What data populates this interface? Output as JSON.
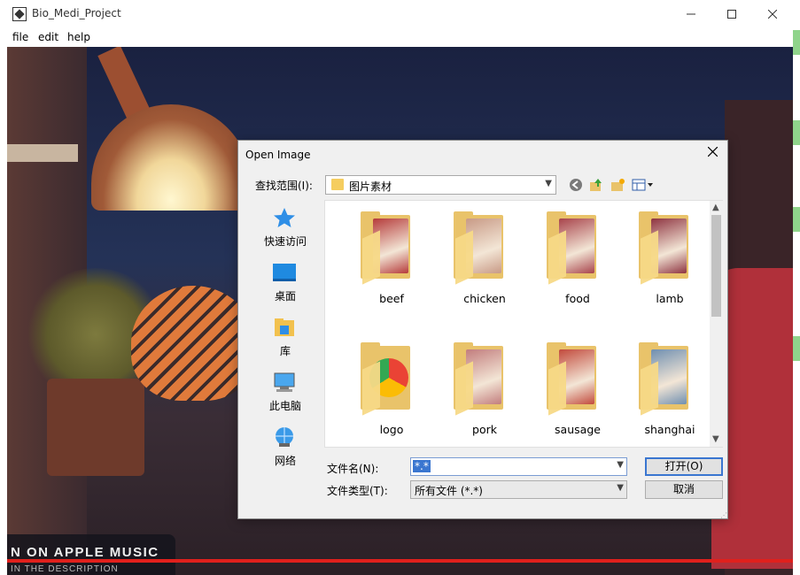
{
  "window": {
    "title": "Bio_Medi_Project"
  },
  "menu": [
    "file",
    "edit",
    "help"
  ],
  "background": {
    "banner_text": "N ON APPLE MUSIC",
    "banner_sub": "IN THE DESCRIPTION"
  },
  "dialog": {
    "title": "Open Image",
    "look_in_label": "查找范围(I):",
    "look_in_value": "图片素材",
    "places": [
      "快速访问",
      "桌面",
      "库",
      "此电脑",
      "网络"
    ],
    "items": [
      {
        "label": "beef",
        "color": "#b53a3a"
      },
      {
        "label": "chicken",
        "color": "#c89a86"
      },
      {
        "label": "food",
        "color": "#a8434b"
      },
      {
        "label": "lamb",
        "color": "#8e3340"
      },
      {
        "label": "logo",
        "color": "#4285f4"
      },
      {
        "label": "pork",
        "color": "#c27d7d"
      },
      {
        "label": "sausage",
        "color": "#c24a3c"
      },
      {
        "label": "shanghai",
        "color": "#6f8fb0"
      }
    ],
    "file_name_label": "文件名(N):",
    "file_name_value": "*.*",
    "file_type_label": "文件类型(T):",
    "file_type_value": "所有文件 (*.*)",
    "open_label": "打开(O)",
    "cancel_label": "取消"
  },
  "colors": {
    "accent": "#3a76d0",
    "folder": "#e9c36a",
    "progress": "#e0201c"
  }
}
